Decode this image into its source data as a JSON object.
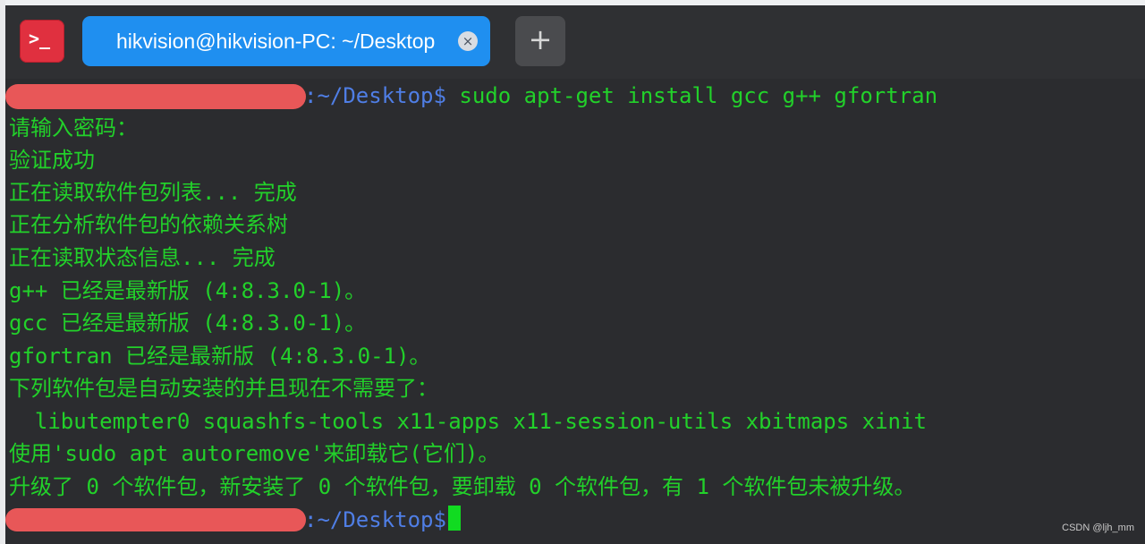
{
  "window": {
    "tab_title": "hikvision@hikvision-PC: ~/Desktop",
    "tab_close_icon": "×",
    "new_tab_icon": "+"
  },
  "terminal": {
    "lines": [
      {
        "path": ":~/Desktop$",
        "command": " sudo apt-get install gcc g++ gfortran"
      },
      {
        "text": "请输入密码："
      },
      {
        "text": "验证成功"
      },
      {
        "text": "正在读取软件包列表... 完成"
      },
      {
        "text": "正在分析软件包的依赖关系树"
      },
      {
        "text": "正在读取状态信息... 完成"
      },
      {
        "text": "g++ 已经是最新版 (4:8.3.0-1)。"
      },
      {
        "text": "gcc 已经是最新版 (4:8.3.0-1)。"
      },
      {
        "text": "gfortran 已经是最新版 (4:8.3.0-1)。"
      },
      {
        "text": "下列软件包是自动安装的并且现在不需要了："
      },
      {
        "text": "  libutempter0 squashfs-tools x11-apps x11-session-utils xbitmaps xinit"
      },
      {
        "text": "使用'sudo apt autoremove'来卸载它(它们)。"
      },
      {
        "text": "升级了 0 个软件包，新安装了 0 个软件包，要卸载 0 个软件包，有 1 个软件包未被升级。"
      },
      {
        "path": ":~/Desktop$"
      }
    ]
  },
  "watermark": "CSDN @ljh_mm",
  "colors": {
    "terminal_text": "#22d12a",
    "prompt_path": "#4f7ee5",
    "tab_active": "#1f8ff0",
    "app_icon": "#e0303f",
    "redaction": "#f05a5a",
    "background": "#2b2c2f"
  }
}
